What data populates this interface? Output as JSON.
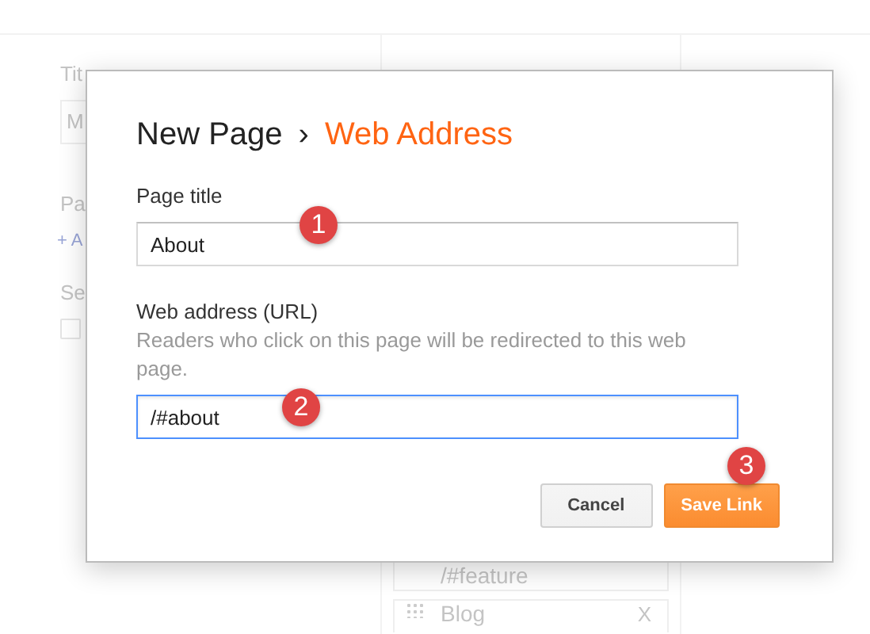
{
  "background": {
    "left": [
      {
        "kind": "label",
        "text": "Tit"
      },
      {
        "kind": "input",
        "text": "M"
      },
      {
        "kind": "label",
        "text": "Pa"
      },
      {
        "kind": "link",
        "text": "+ A"
      },
      {
        "kind": "label",
        "text": "Se"
      },
      {
        "kind": "checkbox",
        "checked": false
      }
    ],
    "page_items": [
      {
        "text": "/#feature"
      },
      {
        "text": "Blog",
        "remove": "X"
      }
    ]
  },
  "dialog": {
    "title_parent": "New Page",
    "separator": "›",
    "title_current": "Web Address",
    "fields": [
      {
        "label": "Page title",
        "value": "About",
        "focused": false,
        "marker": "1"
      },
      {
        "label": "Web address (URL)",
        "help": "Readers who click on this page will be redirected to this web page.",
        "value": "/#about",
        "focused": true,
        "marker": "2"
      }
    ],
    "buttons": [
      {
        "label": "Cancel",
        "kind": "secondary"
      },
      {
        "label": "Save Link",
        "kind": "primary",
        "marker": "3"
      }
    ]
  }
}
